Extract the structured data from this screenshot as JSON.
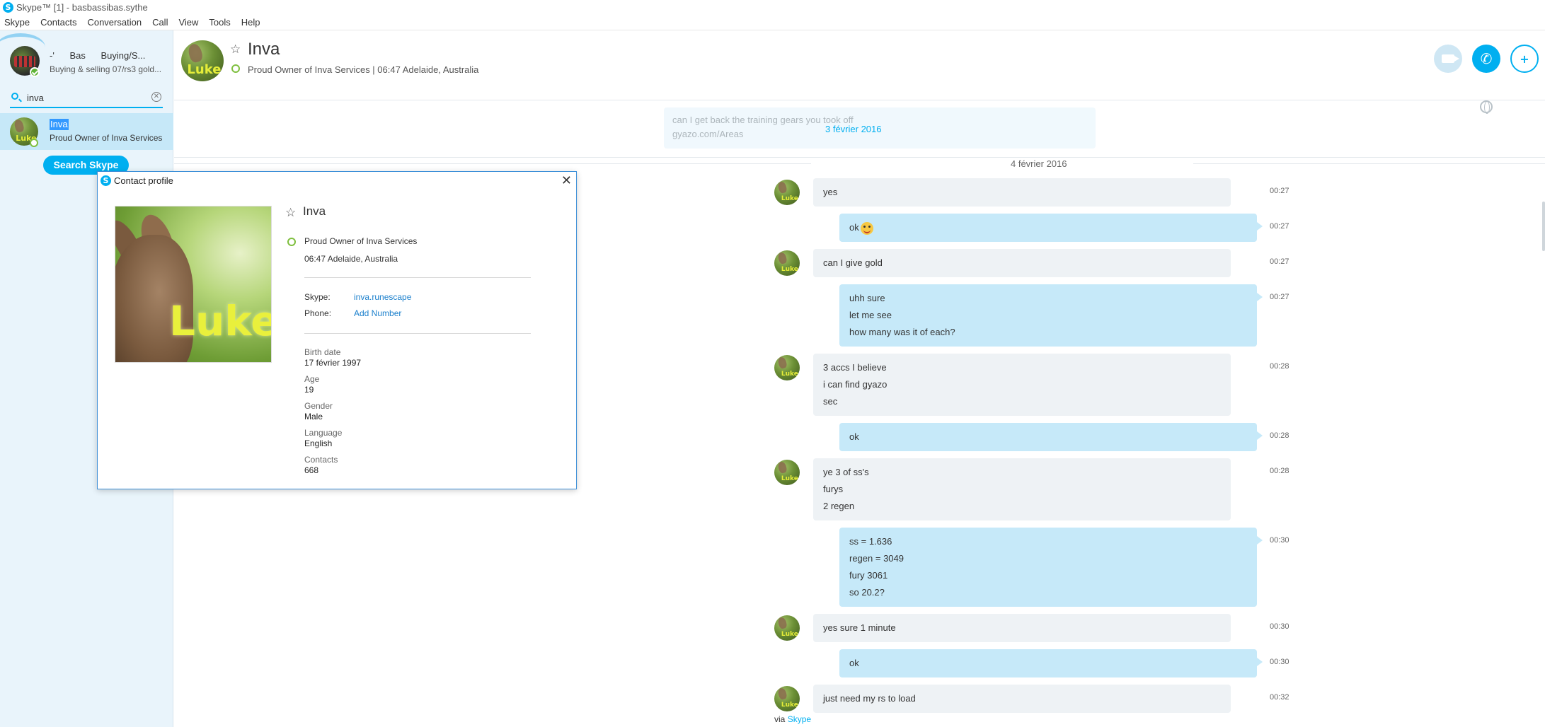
{
  "window": {
    "title": "Skype™ [1] - basbassibas.sythe"
  },
  "menu": [
    "Skype",
    "Contacts",
    "Conversation",
    "Call",
    "View",
    "Tools",
    "Help"
  ],
  "me": {
    "name_a": "-'",
    "name_b": "Bas",
    "name_c": "Buying/S...",
    "mood": "Buying & selling 07/rs3 gold..."
  },
  "search": {
    "value": "inva",
    "clear_glyph": "✕",
    "button": "Search Skype"
  },
  "result": {
    "name": "Inva",
    "sub": "Proud Owner of Inva Services",
    "avatar_text": "Luke"
  },
  "header": {
    "name": "Inva",
    "sub": "Proud Owner of Inva Services | 06:47 Adelaide, Australia",
    "star": "☆",
    "avatar_text": "Luke",
    "phone_glyph": "✆",
    "add_glyph": "+"
  },
  "chat": {
    "faded_line1": "can I get back the training gears you took off",
    "faded_line2": "gyazo.com/Areas",
    "faded_date": "3 février 2016",
    "date": "4 février 2016",
    "messages": [
      {
        "dir": "in",
        "lines": [
          "yes"
        ],
        "time": "00:27"
      },
      {
        "dir": "out",
        "lines": [
          "ok"
        ],
        "emoji": true,
        "time": "00:27"
      },
      {
        "dir": "in",
        "lines": [
          "can I give gold"
        ],
        "time": "00:27"
      },
      {
        "dir": "out",
        "lines": [
          "uhh sure",
          "let me see",
          "how many was it of each?"
        ],
        "time": "00:27"
      },
      {
        "dir": "in",
        "lines": [
          "3 accs I believe",
          "i can find gyazo",
          "sec"
        ],
        "time": "00:28"
      },
      {
        "dir": "out",
        "lines": [
          "ok"
        ],
        "time": "00:28"
      },
      {
        "dir": "in",
        "lines": [
          "ye 3 of ss's",
          "furys",
          "2 regen"
        ],
        "time": "00:28"
      },
      {
        "dir": "out",
        "lines": [
          "ss = 1.636",
          "regen = 3049",
          "fury 3061",
          "so 20.2?"
        ],
        "time": "00:30"
      },
      {
        "dir": "in",
        "lines": [
          "yes sure 1 minute"
        ],
        "time": "00:30"
      },
      {
        "dir": "out",
        "lines": [
          "ok"
        ],
        "time": "00:30"
      },
      {
        "dir": "in",
        "lines": [
          "just need my rs to load"
        ],
        "time": "00:32"
      }
    ],
    "via_prefix": "via",
    "via_link": "Skype"
  },
  "profile_dialog": {
    "title": "Contact profile",
    "close_glyph": "✕",
    "name": "Inva",
    "picture_text": "Luke",
    "mood": "Proud Owner of Inva Services",
    "local_time": "06:47 Adelaide, Australia",
    "skype_label": "Skype:",
    "skype_value": "inva.runescape",
    "phone_label": "Phone:",
    "phone_value": "Add Number",
    "fields": [
      {
        "label": "Birth date",
        "value": "17 février 1997"
      },
      {
        "label": "Age",
        "value": "19"
      },
      {
        "label": "Gender",
        "value": "Male"
      },
      {
        "label": "Language",
        "value": "English"
      },
      {
        "label": "Contacts",
        "value": "668"
      }
    ]
  },
  "colors": {
    "accent": "#00aff0",
    "sidebar_bg": "#e9f4fb",
    "outgoing_bubble": "#c6e9f9",
    "incoming_bubble": "#eef2f5",
    "selection": "#3399ff"
  }
}
